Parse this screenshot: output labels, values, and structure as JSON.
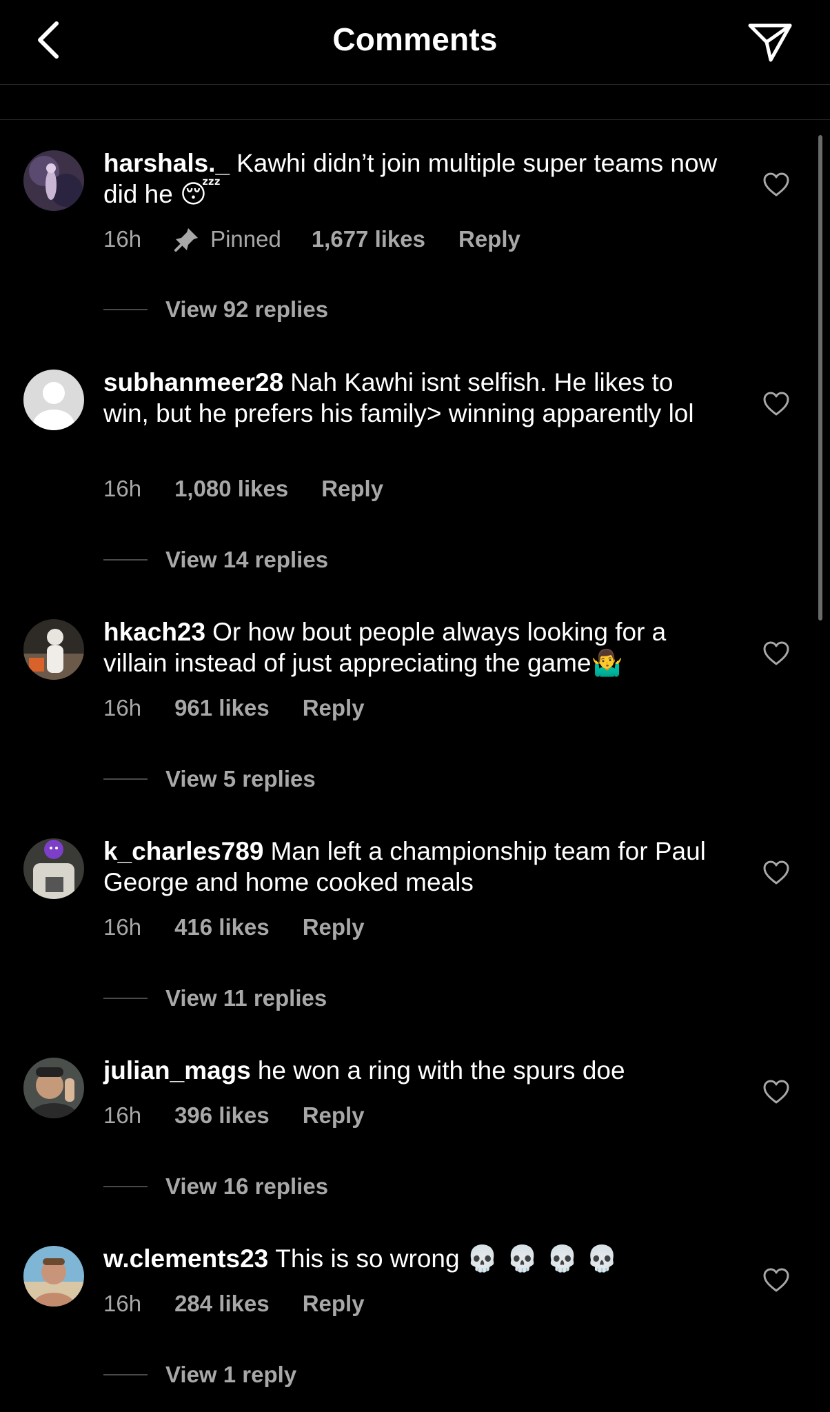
{
  "header": {
    "title": "Comments",
    "back_icon": "chevron-left-icon",
    "share_icon": "paper-plane-icon"
  },
  "colors": {
    "background": "#000000",
    "primary_text": "#ffffff",
    "secondary_text": "#a8a8a8",
    "divider": "#262626"
  },
  "comments": [
    {
      "username": "harshals._",
      "text": "Kawhi didn’t join multiple super teams now did he",
      "emoji": "😴",
      "time": "16h",
      "pinned_label": "Pinned",
      "likes": "1,677 likes",
      "reply_label": "Reply",
      "view_replies": "View 92 replies"
    },
    {
      "username": "subhanmeer28",
      "text": "Nah Kawhi isnt selfish. He likes to win, but he prefers his family> winning apparently lol",
      "emoji": "",
      "time": "16h",
      "likes": "1,080 likes",
      "reply_label": "Reply",
      "view_replies": "View 14 replies"
    },
    {
      "username": "hkach23",
      "text": "Or how bout people always looking for a villain instead of just appreciating the game",
      "emoji": "🤷‍♂️",
      "time": "16h",
      "likes": "961 likes",
      "reply_label": "Reply",
      "view_replies": "View 5 replies"
    },
    {
      "username": "k_charles789",
      "text": "Man left a championship team for Paul George and home cooked meals",
      "emoji": "",
      "time": "16h",
      "likes": "416 likes",
      "reply_label": "Reply",
      "view_replies": "View 11 replies"
    },
    {
      "username": "julian_mags",
      "text": "he won a ring with the spurs doe",
      "emoji": "",
      "time": "16h",
      "likes": "396 likes",
      "reply_label": "Reply",
      "view_replies": "View 16 replies"
    },
    {
      "username": "w.clements23",
      "text": "This is so wrong",
      "emoji": "💀 💀 💀 💀",
      "time": "16h",
      "likes": "284 likes",
      "reply_label": "Reply",
      "view_replies": "View 1 reply"
    }
  ]
}
